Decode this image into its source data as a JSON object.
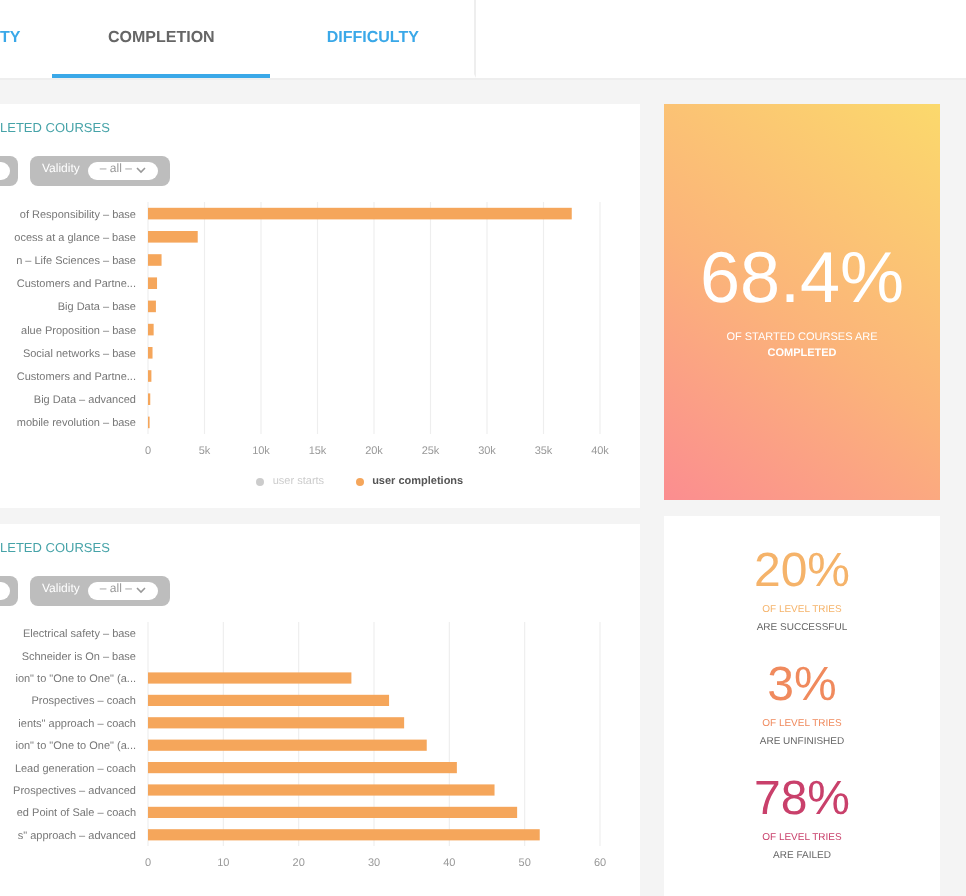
{
  "tabs": [
    {
      "label": "TY",
      "selected": false
    },
    {
      "label": "COMPLETION",
      "selected": true
    },
    {
      "label": "DIFFICULTY",
      "selected": false
    }
  ],
  "panels": [
    {
      "title": "LETED COURSES",
      "filters": [
        {
          "kind": "cut"
        },
        {
          "kind": "labeled",
          "label": "Validity",
          "value": "– all –"
        }
      ],
      "chart_data": {
        "type": "bar",
        "orientation": "horizontal",
        "categories": [
          "of Responsibility – base",
          "ocess at a glance – base",
          "n – Life Sciences – base",
          "Customers and Partne...",
          "Big Data – base",
          "alue Proposition – base",
          "Social networks – base",
          "Customers and Partne...",
          "Big Data – advanced",
          "mobile revolution – base"
        ],
        "series": [
          {
            "name": "user starts",
            "color": "#cccccc",
            "values": [
              null,
              null,
              null,
              null,
              null,
              null,
              null,
              null,
              null,
              null
            ]
          },
          {
            "name": "user completions",
            "color": "#f5a65b",
            "values": [
              37500,
              4400,
              1200,
              800,
              700,
              500,
              400,
              300,
              200,
              100
            ]
          }
        ],
        "grid": true,
        "xlim": [
          0,
          40000
        ],
        "xticks": [
          {
            "value": 0,
            "label": "0"
          },
          {
            "value": 5000,
            "label": "5k"
          },
          {
            "value": 10000,
            "label": "10k"
          },
          {
            "value": 15000,
            "label": "15k"
          },
          {
            "value": 20000,
            "label": "20k"
          },
          {
            "value": 25000,
            "label": "25k"
          },
          {
            "value": 30000,
            "label": "30k"
          },
          {
            "value": 35000,
            "label": "35k"
          },
          {
            "value": 40000,
            "label": "40k"
          }
        ]
      },
      "legend": [
        {
          "selected": false
        },
        {
          "selected": true
        }
      ]
    },
    {
      "title": "LETED COURSES",
      "filters": [
        {
          "kind": "cut"
        },
        {
          "kind": "labeled",
          "label": "Validity",
          "value": "– all –"
        }
      ],
      "chart_data": {
        "type": "bar",
        "orientation": "horizontal",
        "categories": [
          "Electrical safety – base",
          "Schneider is On – base",
          "ion\" to \"One to One\" (a...",
          "Prospectives – coach",
          "ients\" approach – coach",
          "ion\" to \"One to One\" (a...",
          "Lead generation – coach",
          "Prospectives – advanced",
          "ed Point of Sale – coach",
          "s\" approach – advanced"
        ],
        "series": [
          {
            "color": "#f5a65b",
            "values": [
              0,
              0,
              27,
              32,
              34,
              37,
              41,
              46,
              49,
              52
            ]
          }
        ],
        "grid": true,
        "xlim": [
          0,
          60
        ],
        "xticks": [
          0,
          10,
          20,
          30,
          40,
          50,
          60
        ]
      }
    }
  ],
  "highlight": {
    "value": "68.4%",
    "line1": "OF STARTED COURSES ARE",
    "line2": "COMPLETED"
  },
  "stats": [
    {
      "value": "20%",
      "line1": "OF LEVEL TRIES",
      "line2": "ARE SUCCESSFUL",
      "color": "#f5b36a"
    },
    {
      "value": "3%",
      "line1": "OF LEVEL TRIES",
      "line2": "ARE UNFINISHED",
      "color": "#f08a5d"
    },
    {
      "value": "78%",
      "line1": "OF LEVEL TRIES",
      "line2": "ARE FAILED",
      "color": "#c9406b"
    }
  ]
}
